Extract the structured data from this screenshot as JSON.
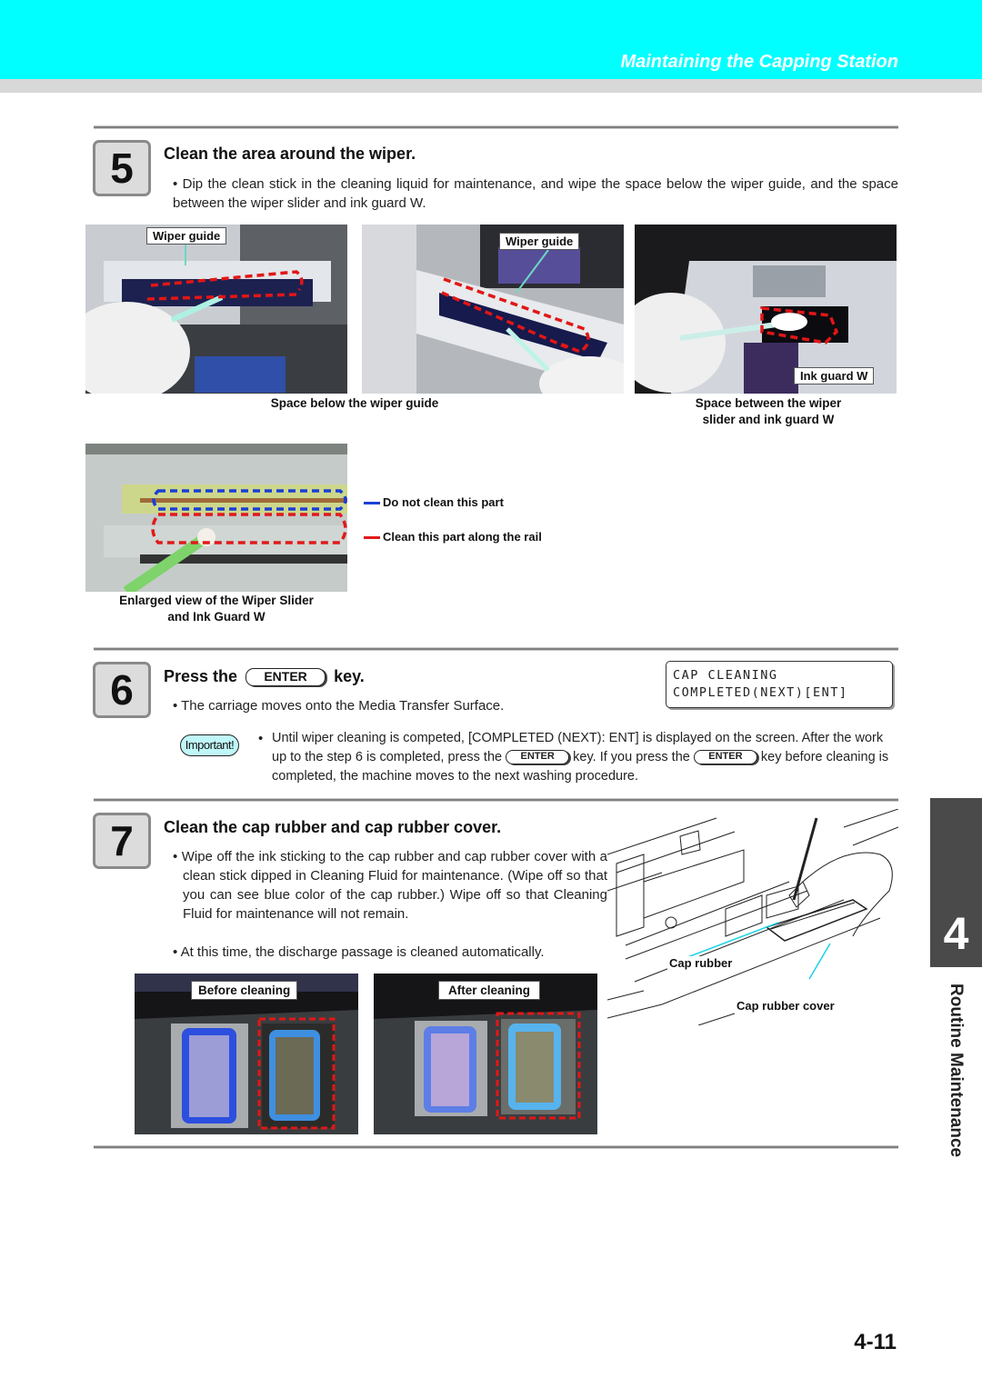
{
  "header": {
    "section_title": "Maintaining the Capping Station",
    "band_color": "#00ffff"
  },
  "step5": {
    "number": "5",
    "title": "Clean the area around the wiper.",
    "bullet": "• Dip the clean stick in the cleaning liquid for maintenance, and wipe the space below the wiper guide, and the space between the wiper slider and ink guard W.",
    "photo1_label": "Wiper guide",
    "photo2_label": "Wiper guide",
    "photo3_label": "Ink guard W",
    "caption_left": "Space below the wiper guide",
    "caption_right_line1": "Space between the wiper",
    "caption_right_line2": "slider and ink guard W",
    "enlarged_caption_line1": "Enlarged view of the Wiper Slider",
    "enlarged_caption_line2": "and Ink Guard W",
    "legend": [
      {
        "text": "Do not clean this part",
        "color": "#1a3fd6"
      },
      {
        "text": "Clean this part along the rail",
        "color": "#e01a1a"
      }
    ]
  },
  "step6": {
    "number": "6",
    "title_before": "Press the",
    "key_label": "ENTER",
    "title_after": "key.",
    "bullet": "• The carriage moves onto the Media Transfer Surface.",
    "lcd_line1": "CAP CLEANING",
    "lcd_line2": "COMPLETED(NEXT)[ENT]",
    "important_badge": "Important!",
    "important_part1": "Until wiper cleaning is competed, [COMPLETED (NEXT): ENT] is displayed on the screen. After the work up to the step 6 is completed, press the",
    "important_key1": "ENTER",
    "important_part2": "key. If you press the",
    "important_key2": "ENTER",
    "important_part3": "key before cleaning is completed, the machine moves to the next washing procedure."
  },
  "step7": {
    "number": "7",
    "title": "Clean the cap rubber and cap rubber cover.",
    "bullet1": "• Wipe off the ink sticking to the cap rubber and cap rubber cover with a clean stick dipped in Cleaning Fluid for maintenance. (Wipe off so that you can see blue color of the cap rubber.) Wipe off so that Cleaning Fluid for maintenance will not remain.",
    "bullet2": "• At this time, the discharge passage is cleaned automatically.",
    "before_label": "Before cleaning",
    "after_label": "After cleaning",
    "diagram_label_rubber": "Cap rubber",
    "diagram_label_cover": "Cap rubber cover"
  },
  "side_tab": {
    "chapter_number": "4",
    "chapter_title": "Routine Maintenance"
  },
  "footer": {
    "page_number": "4-11"
  }
}
